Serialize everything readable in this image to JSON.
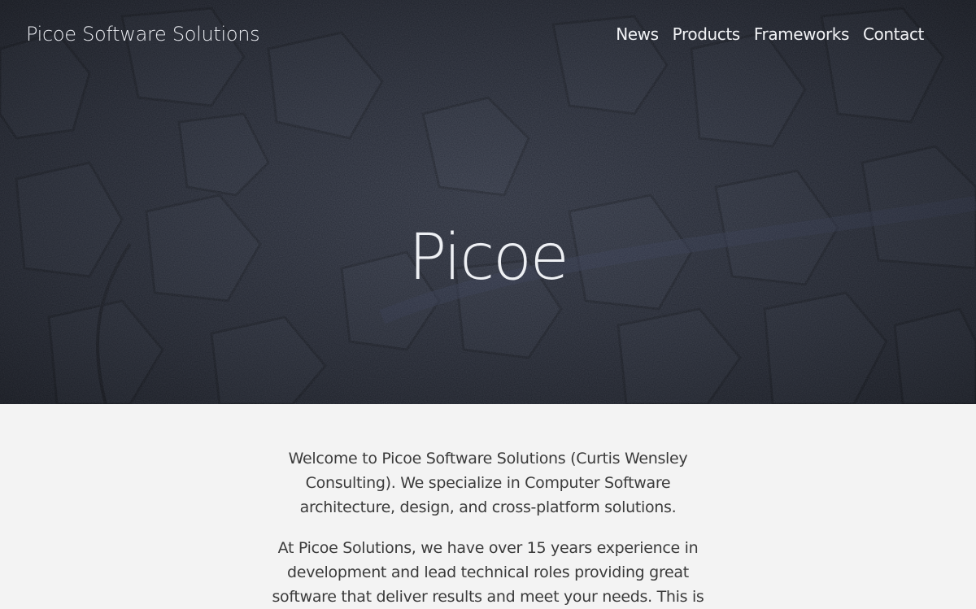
{
  "header": {
    "brand": "Picoe Software Solutions",
    "nav": [
      "News",
      "Products",
      "Frameworks",
      "Contact"
    ]
  },
  "hero": {
    "title": "Picoe"
  },
  "content": {
    "paragraphs": [
      "Welcome to Picoe Software Solutions (Curtis Wensley Consulting). We specialize in Computer Software architecture, design, and cross-platform solutions.",
      "At Picoe Solutions, we have over 15 years experience in development and lead technical roles providing great software that deliver results and meet your needs. This is"
    ]
  },
  "colors": {
    "hero_bg": "#22252f",
    "content_bg": "#f3f3f3",
    "text": "#3b3b3b"
  }
}
